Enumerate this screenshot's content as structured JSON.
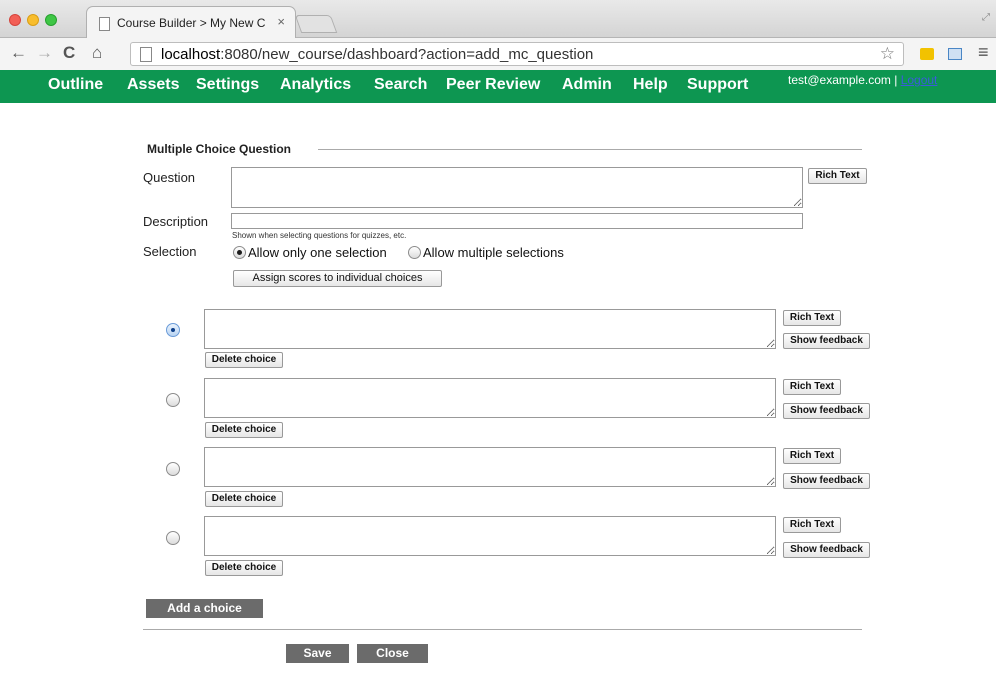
{
  "browser": {
    "tab_title": "Course Builder > My New C",
    "tab_close": "×",
    "url_host": "localhost",
    "url_rest": ":8080/new_course/dashboard?action=add_mc_question",
    "back": "←",
    "forward": "→",
    "reload": "C",
    "home": "⌂",
    "star": "☆",
    "menu": "≡",
    "resize": "⤢"
  },
  "nav": {
    "items": [
      "Outline",
      "Assets",
      "Settings",
      "Analytics",
      "Search",
      "Peer Review",
      "Admin",
      "Help",
      "Support"
    ],
    "user_email": "test@example.com",
    "separator": " | ",
    "logout": "Logout"
  },
  "form": {
    "legend": "Multiple Choice Question",
    "question_label": "Question",
    "question_value": "",
    "rich_text": "Rich Text",
    "description_label": "Description",
    "description_value": "",
    "description_hint": "Shown when selecting questions for quizzes, etc.",
    "selection_label": "Selection",
    "selection_options": [
      "Allow only one selection",
      "Allow multiple selections"
    ],
    "selection_selected": 0,
    "assign_scores": "Assign scores to individual choices",
    "choices": [
      {
        "text": "",
        "correct": true
      },
      {
        "text": "",
        "correct": false
      },
      {
        "text": "",
        "correct": false
      },
      {
        "text": "",
        "correct": false
      }
    ],
    "choice_rich_text": "Rich Text",
    "show_feedback": "Show feedback",
    "delete_choice": "Delete choice",
    "add_choice": "Add a choice",
    "save": "Save",
    "close": "Close"
  }
}
